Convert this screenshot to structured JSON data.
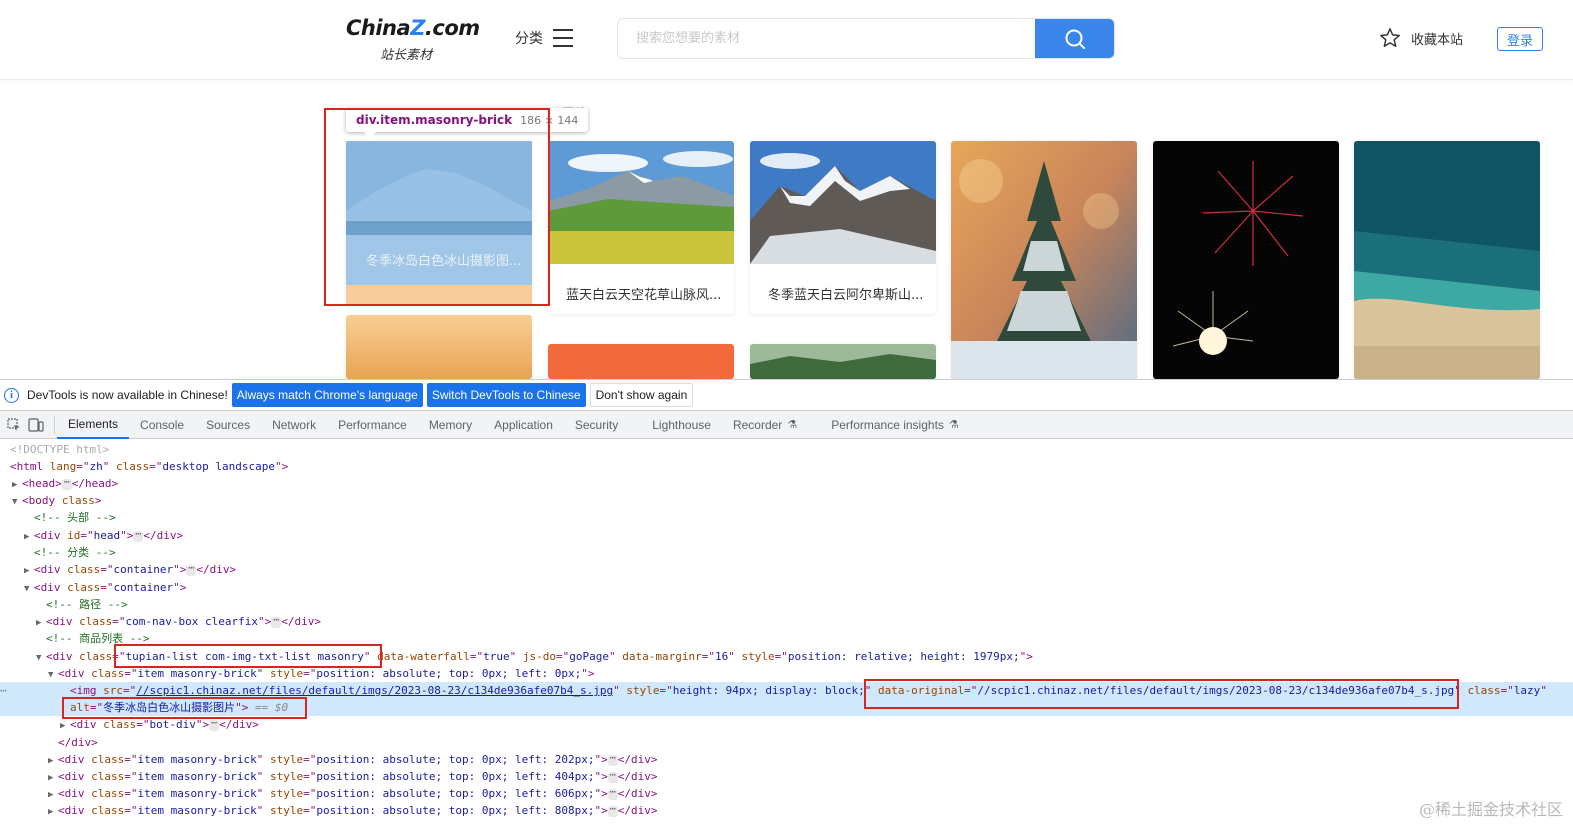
{
  "header": {
    "logo_main_prefix": "China",
    "logo_main_z": "Z",
    "logo_main_suffix": ".com",
    "logo_sub": "站长素材",
    "category_label": "分类",
    "search_placeholder": "搜索您想要的素材",
    "favorite_label": "收藏本站",
    "login_label": "登录"
  },
  "gallery": {
    "section_label": "图片",
    "highlight_caption": "冬季冰岛白色冰山摄影图...",
    "inspect_tooltip": {
      "tag": "div.item.masonry-brick",
      "dims": "186 × 144"
    },
    "cards": [
      {
        "caption": "蓝天白云天空花草山脉风..."
      },
      {
        "caption": "冬季蓝天白云阿尔卑斯山..."
      }
    ]
  },
  "devtools": {
    "infobar": {
      "message": "DevTools is now available in Chinese!",
      "btn_match": "Always match Chrome's language",
      "btn_switch": "Switch DevTools to Chinese",
      "btn_dismiss": "Don't show again"
    },
    "tabs": [
      "Elements",
      "Console",
      "Sources",
      "Network",
      "Performance",
      "Memory",
      "Application",
      "Security",
      "Lighthouse",
      "Recorder",
      "Performance insights"
    ],
    "active_tab": "Elements",
    "dom": {
      "doctype": "<!DOCTYPE html>",
      "html_open_tag": "html",
      "html_lang": "zh",
      "html_class": "desktop landscape",
      "head": "head",
      "body": "body",
      "c_head": "<!-- 头部 -->",
      "head_div_id": "head",
      "c_category": "<!-- 分类 -->",
      "container": "container",
      "c_path": "<!-- 路径 -->",
      "nav_class": "com-nav-box clearfix",
      "c_list": "<!-- 商品列表 -->",
      "list_class": "tupian-list com-img-txt-list masonry",
      "list_waterfall": "true",
      "list_jsdo": "goPage",
      "list_marginr": "16",
      "list_style": "position: relative; height: 1979px;",
      "item_class": "item masonry-brick",
      "item0_style": "position: absolute; top: 0px; left: 0px;",
      "img_src": "//scpic1.chinaz.net/files/default/imgs/2023-08-23/c134de936afe07b4_s.jpg",
      "img_style": "height: 94px; display: block;",
      "img_data_original": "//scpic1.chinaz.net/files/default/imgs/2023-08-23/c134de936afe07b4_s.jpg",
      "img_class": "lazy",
      "img_alt": "冬季冰岛白色冰山摄影图片",
      "eq_sel": "== $0",
      "bot_div_class": "bot-div",
      "item_styles": [
        "position: absolute; top: 0px; left: 202px;",
        "position: absolute; top: 0px; left: 404px;",
        "position: absolute; top: 0px; left: 606px;",
        "position: absolute; top: 0px; left: 808px;"
      ]
    }
  },
  "watermark": "@稀土掘金技术社区",
  "colors": {
    "accent_blue": "#3a86ea",
    "highlight_red": "#d9251d",
    "devtools_blue": "#1a73e8"
  }
}
